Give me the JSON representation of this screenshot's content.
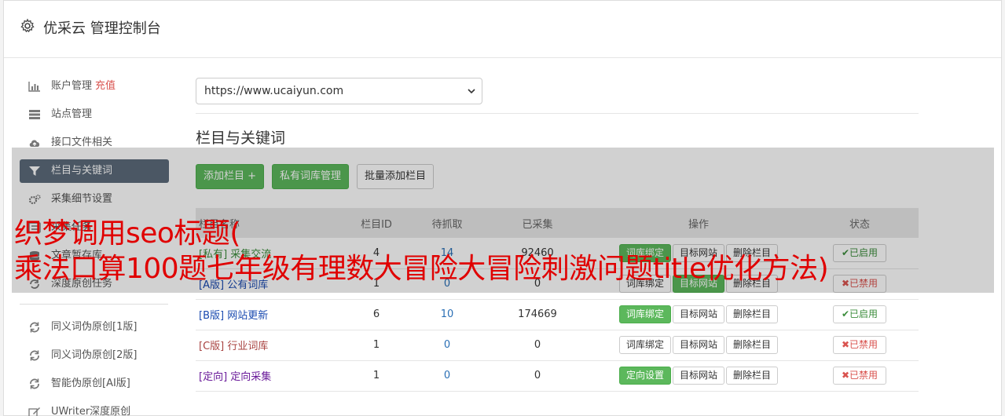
{
  "header": {
    "title": "优采云 管理控制台"
  },
  "sidebar": {
    "items": [
      {
        "label": "账户管理",
        "extra": "充值",
        "icon": "bar-chart-icon"
      },
      {
        "label": "站点管理",
        "icon": "server-icon"
      },
      {
        "label": "接口文件相关",
        "icon": "cloud-upload-icon"
      },
      {
        "label": "栏目与关键词",
        "icon": "filter-icon"
      },
      {
        "label": "采集细节设置",
        "icon": "cogs-icon"
      },
      {
        "label": "采集任务",
        "icon": "tasks-icon"
      },
      {
        "label": "文章暂存库",
        "icon": "database-icon"
      },
      {
        "label": "深度原创任务",
        "icon": "repeat-icon"
      }
    ],
    "tools": [
      {
        "label": "同义词伪原创[1版]",
        "icon": "refresh-icon"
      },
      {
        "label": "同义词伪原创[2版]",
        "icon": "refresh-icon"
      },
      {
        "label": "智能伪原创[AI版]",
        "icon": "refresh-icon"
      },
      {
        "label": "UWriter深度原创",
        "icon": "edit-icon"
      }
    ]
  },
  "main": {
    "site_select": "https://www.ucaiyun.com",
    "section_title": "栏目与关键词",
    "buttons": {
      "add_column": "添加栏目 +",
      "private_lib": "私有词库管理",
      "batch_add": "批量添加栏目"
    },
    "table": {
      "headers": {
        "name": "栏目名称",
        "id": "栏目ID",
        "pending": "待抓取",
        "collected": "已采集",
        "ops": "操作",
        "status": "状态"
      },
      "rows": [
        {
          "tag": "[私有]",
          "name": "采集交流",
          "id": "4",
          "pending": "14",
          "collected": "92460",
          "op1": "词库绑定",
          "op2": "目标网站",
          "op3": "删除栏目",
          "status": "✔已启用"
        },
        {
          "tag": "[A版]",
          "name": "公有词库",
          "id": "1",
          "pending": "0",
          "collected": "0",
          "op1": "词库绑定",
          "op2": "目标网站",
          "op3": "删除栏目",
          "status": "✖已禁用"
        },
        {
          "tag": "[B版]",
          "name": "网站更新",
          "id": "6",
          "pending": "10",
          "collected": "174669",
          "op1": "词库绑定",
          "op2": "目标网站",
          "op3": "删除栏目",
          "status": "✔已启用"
        },
        {
          "tag": "[C版]",
          "name": "行业词库",
          "id": "1",
          "pending": "0",
          "collected": "0",
          "op1": "词库绑定",
          "op2": "目标网站",
          "op3": "删除栏目",
          "status": "✖已禁用"
        },
        {
          "tag": "[定向]",
          "name": "定向采集",
          "id": "1",
          "pending": "0",
          "collected": "0",
          "op1": "定向设置",
          "op2": "目标网站",
          "op3": "删除栏目",
          "status": "✖已禁用"
        }
      ]
    }
  },
  "overlay": {
    "line1": "织梦调用seo标题(",
    "line2": "乘法口算100题七年级有理数大冒险大冒险刺激问题title优化方法)"
  }
}
